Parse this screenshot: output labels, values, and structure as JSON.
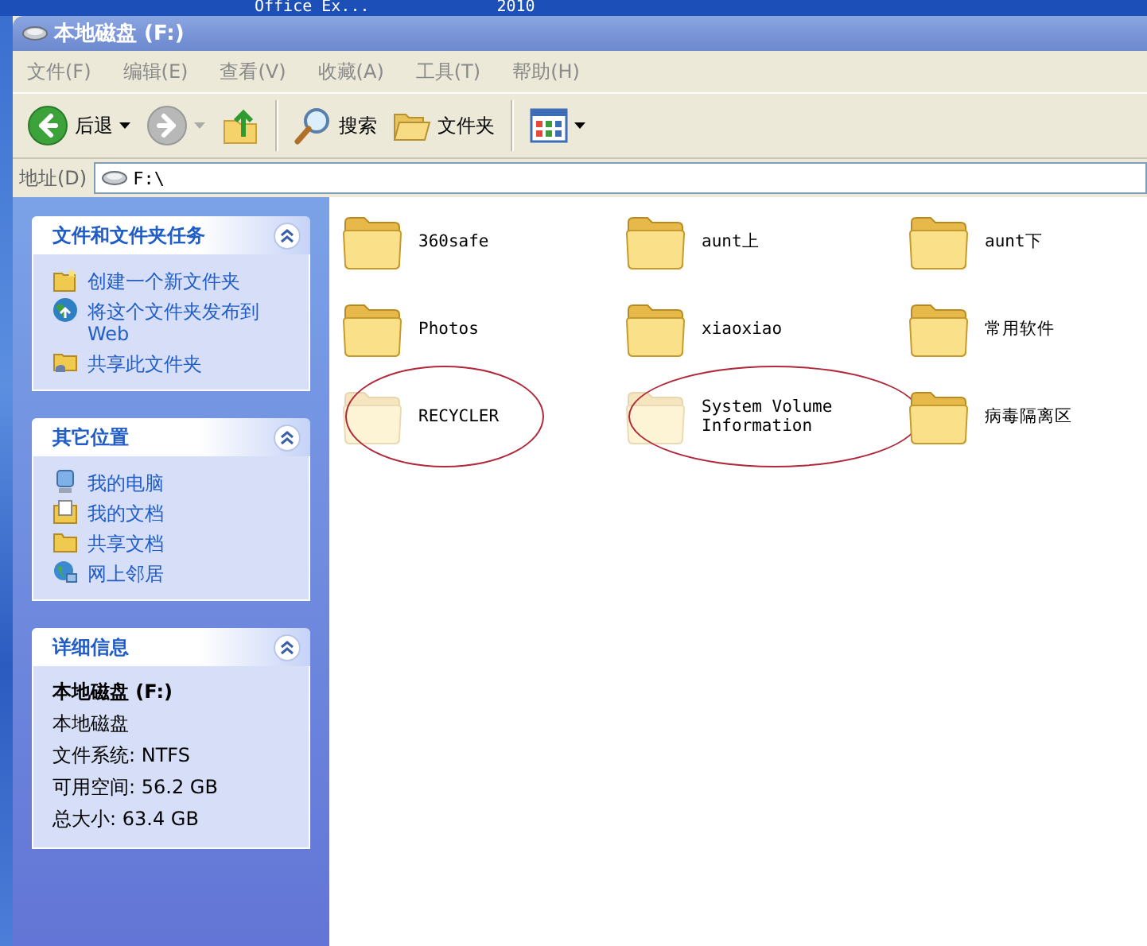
{
  "desktop": {
    "labels": [
      "Office Ex...",
      "2010"
    ]
  },
  "window": {
    "title": "本地磁盘 (F:)"
  },
  "menu": [
    {
      "label": "文件(F)"
    },
    {
      "label": "编辑(E)"
    },
    {
      "label": "查看(V)"
    },
    {
      "label": "收藏(A)"
    },
    {
      "label": "工具(T)"
    },
    {
      "label": "帮助(H)"
    }
  ],
  "toolbar": [
    {
      "kind": "back",
      "label": "后退",
      "disabled": false,
      "dropdown": true
    },
    {
      "kind": "forward",
      "disabled": true,
      "dropdown": true
    },
    {
      "kind": "up"
    },
    {
      "kind": "separator"
    },
    {
      "kind": "search",
      "label": "搜索"
    },
    {
      "kind": "folders",
      "label": "文件夹"
    },
    {
      "kind": "separator"
    },
    {
      "kind": "views",
      "dropdown": true
    }
  ],
  "address": {
    "label": "地址(D)",
    "value": "F:\\"
  },
  "sidebar": [
    {
      "kind": "links",
      "title": "文件和文件夹任务",
      "expanded": true,
      "items": [
        {
          "label": "创建一个新文件夹"
        },
        {
          "label": "将这个文件夹发布到 Web"
        },
        {
          "label": "共享此文件夹"
        }
      ]
    },
    {
      "kind": "links",
      "title": "其它位置",
      "expanded": true,
      "items": [
        {
          "label": "我的电脑"
        },
        {
          "label": "我的文档"
        },
        {
          "label": "共享文档"
        },
        {
          "label": "网上邻居"
        }
      ]
    },
    {
      "kind": "details",
      "title": "详细信息",
      "expanded": true,
      "name": "本地磁盘 (F:)",
      "lines": [
        "本地磁盘",
        "文件系统: NTFS",
        "可用空间: 56.2 GB",
        "总大小: 63.4 GB"
      ]
    }
  ],
  "folders": [
    {
      "name": "360safe",
      "hidden": false,
      "circled": false
    },
    {
      "name": "aunt上",
      "hidden": false,
      "circled": false
    },
    {
      "name": "aunt下",
      "hidden": false,
      "circled": false
    },
    {
      "name": "Photos",
      "hidden": false,
      "circled": false
    },
    {
      "name": "xiaoxiao",
      "hidden": false,
      "circled": false
    },
    {
      "name": "常用软件",
      "hidden": false,
      "circled": false
    },
    {
      "name": "RECYCLER",
      "hidden": true,
      "circled": true
    },
    {
      "name": "System Volume Information",
      "hidden": true,
      "circled": true
    },
    {
      "name": "病毒隔离区",
      "hidden": false,
      "circled": false
    }
  ]
}
